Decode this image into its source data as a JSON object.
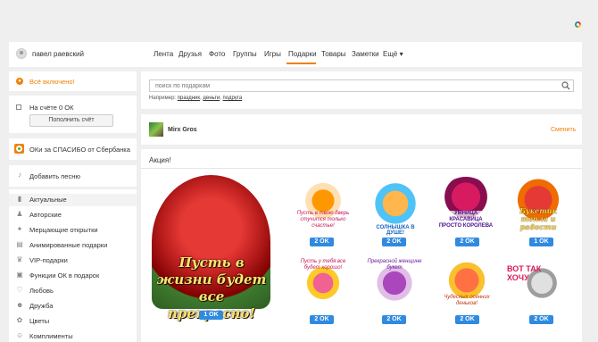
{
  "user": {
    "name": "павел раевский"
  },
  "nav": {
    "items": [
      "Лента",
      "Друзья",
      "Фото",
      "Группы",
      "Игры",
      "Подарки",
      "Товары",
      "Заметки",
      "Ещё ▾"
    ],
    "active": "Подарки"
  },
  "sidebar": {
    "all_included": "Всё включено!",
    "balance_label": "На счёте 0 ОК",
    "topup_button": "Пополнить счёт",
    "sber_label": "ОКи за СПАСИБО от Сбербанка",
    "add_song": "Добавить песню",
    "categories": [
      "Актуальные",
      "Авторские",
      "Мерцающие открытки",
      "Анимированные подарки",
      "VIP-подарки",
      "Функции ОК в подарок",
      "Любовь",
      "Дружба",
      "Цветы",
      "Комплименты"
    ]
  },
  "search": {
    "placeholder": "поиск по подаркам",
    "example_prefix": "Например:",
    "examples": [
      "праздник",
      "деньги",
      "подруга"
    ]
  },
  "recipient": {
    "name": "Mirx Gros",
    "change_link": "Сменить"
  },
  "promo": {
    "title": "Акция!",
    "big_gift_text": "Пусть в жизни будет все прекрасно!",
    "big_gift_price": "1 OK",
    "gifts": [
      {
        "caption": "Пусть в твою дверь стучится только счастье!",
        "price": "2 OK"
      },
      {
        "caption": "СОЛНЫШКА В ДУШЕ!",
        "price": "2 OK"
      },
      {
        "caption": "УМНИЦА КРАСАВИЦА ПРОСТО КОРОЛЕВА",
        "price": "2 OK"
      },
      {
        "caption": "Букетик тепла и радости",
        "price": "1 OK"
      },
      {
        "caption": "Пусть у тебя все будет хорошо!",
        "price": "2 OK"
      },
      {
        "caption": "Прекрасной женщине букет",
        "price": "2 OK"
      },
      {
        "caption": "Чудесных осенних деньков!",
        "price": "2 OK"
      },
      {
        "caption": "ВОТ ТАК ХОЧУ",
        "price": "2 OK"
      }
    ]
  },
  "colors": {
    "accent": "#ee8208",
    "price_blue": "#2f8ae0"
  }
}
